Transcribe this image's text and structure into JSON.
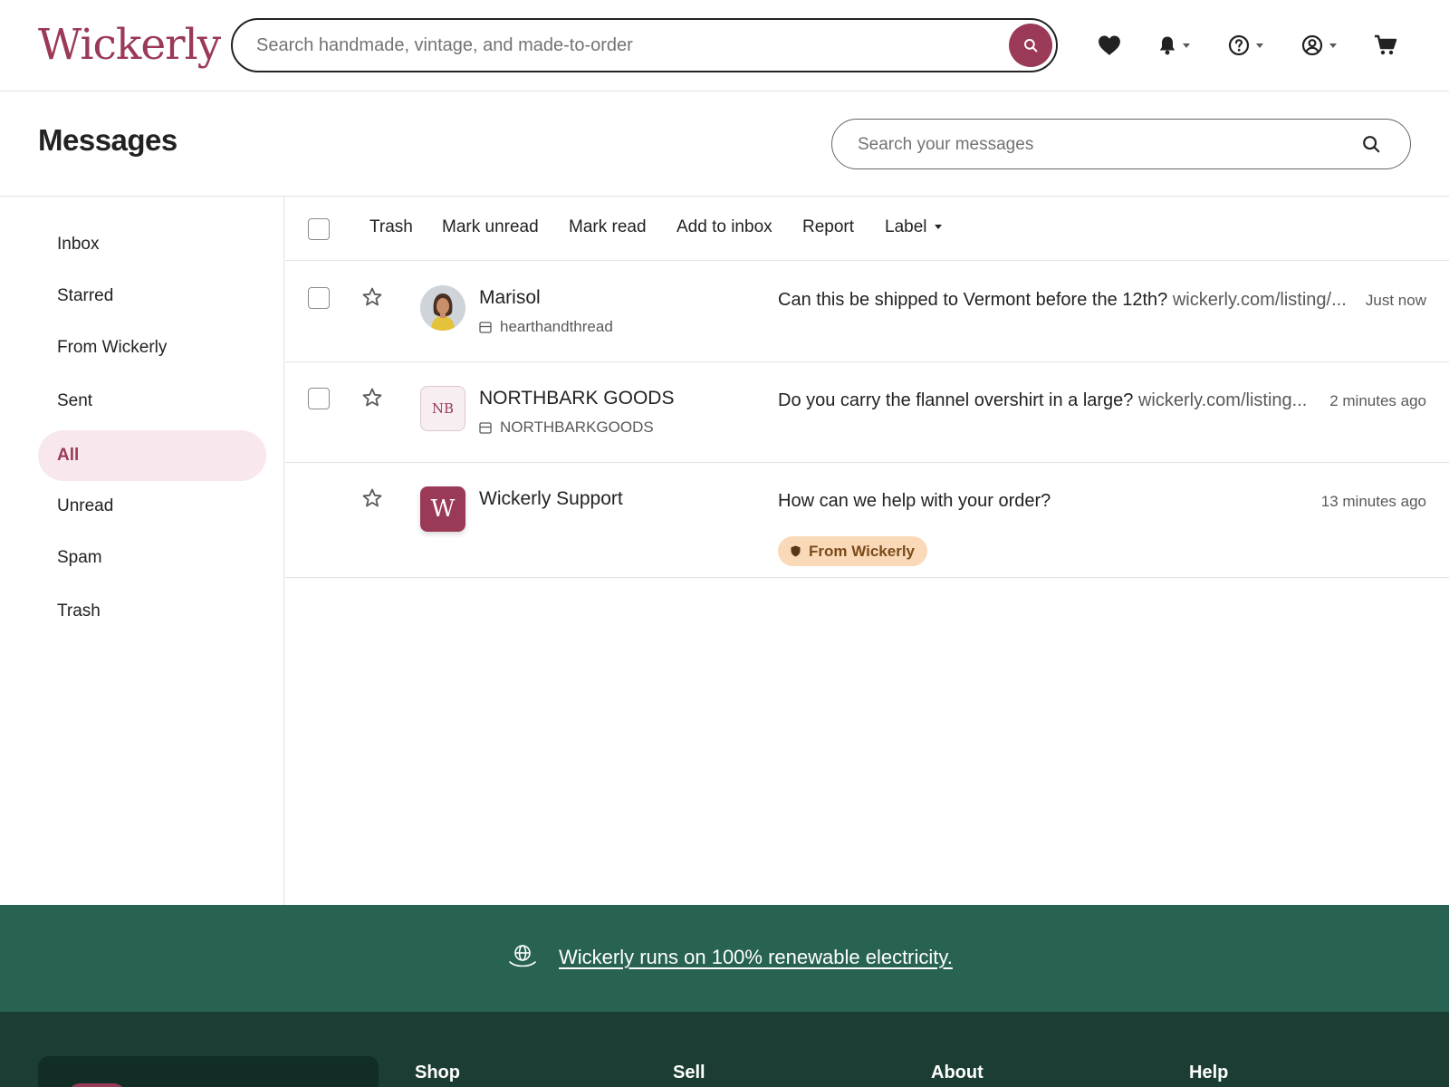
{
  "brand": {
    "name": "Wickerly",
    "accent_color": "#9a3a57"
  },
  "header": {
    "search_placeholder": "Search handmade, vintage, and made-to-order",
    "icons": [
      "heart-icon",
      "bell-icon",
      "help-icon",
      "account-icon",
      "cart-icon"
    ]
  },
  "page": {
    "title": "Messages",
    "search_placeholder": "Search your messages"
  },
  "sidebar": {
    "items": [
      {
        "label": "Inbox",
        "active": false
      },
      {
        "label": "Starred",
        "active": false
      },
      {
        "label": "From Wickerly",
        "active": false
      },
      {
        "label": "Sent",
        "active": false
      },
      {
        "label": "All",
        "active": true
      },
      {
        "label": "Unread",
        "active": false
      },
      {
        "label": "Spam",
        "active": false
      },
      {
        "label": "Trash",
        "active": false
      }
    ]
  },
  "toolbar": {
    "actions": [
      "Trash",
      "Mark unread",
      "Mark read",
      "Add to inbox",
      "Report",
      "Label"
    ]
  },
  "messages": [
    {
      "sender": "Marisol",
      "shop": "hearthandthread",
      "snippet": "Can this be shipped to Vermont before the 12th?",
      "link": "wickerly.com/listing/...",
      "time": "Just now",
      "avatar": "photo"
    },
    {
      "sender": "NORTHBARK GOODS",
      "shop": "NORTHBARKGOODS",
      "snippet": "Do you carry the flannel overshirt in a large?",
      "link": "wickerly.com/listing...",
      "time": "2 minutes ago",
      "avatar_initials": "NB"
    },
    {
      "sender": "Wickerly Support",
      "snippet": "How can we help with your order?",
      "time": "13 minutes ago",
      "avatar_initials": "W",
      "badge": "From Wickerly",
      "badge_color": "#fad9b8"
    }
  ],
  "eco_banner": {
    "text": "Wickerly runs on 100% renewable electricity.",
    "background": "#276253"
  },
  "footer": {
    "columns": [
      "Shop",
      "Sell",
      "About",
      "Help"
    ],
    "background": "#1b3d33"
  }
}
